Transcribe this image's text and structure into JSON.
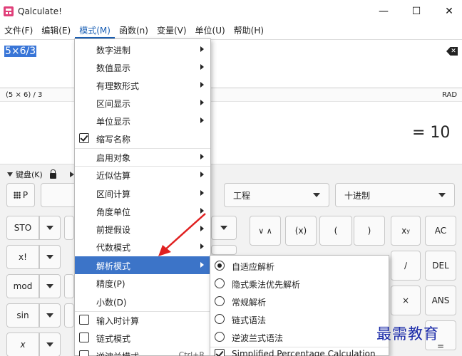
{
  "window": {
    "title": "Qalculate!",
    "minimize": "—",
    "maximize": "☐",
    "close": "✕"
  },
  "menubar": [
    "文件(F)",
    "编辑(E)",
    "模式(M)",
    "函数(n)",
    "变量(V)",
    "单位(U)",
    "帮助(H)"
  ],
  "expression": {
    "value": "5×6/3"
  },
  "parsed": {
    "text": "(5 × 6) / 3",
    "angle_unit": "RAD"
  },
  "result": {
    "text": "= 10"
  },
  "keypad": {
    "header_label": "键盘(K)",
    "fn_button": "P",
    "mode_combo": "工程",
    "base_combo": "十进制",
    "left_buttons": [
      "STO",
      "x!",
      "mod",
      "sin",
      "x"
    ],
    "right_row1": [
      "(x)",
      "(",
      ")",
      "x",
      "AC"
    ],
    "xy_superscript": "y",
    "side_ops": [
      "∕",
      "×",
      "="
    ],
    "side_right": [
      "DEL",
      "ANS"
    ],
    "updown": "∨ ∧"
  },
  "mode_menu": {
    "items": [
      {
        "label": "数字进制",
        "submenu": true
      },
      {
        "label": "数值显示",
        "submenu": true
      },
      {
        "label": "有理数形式",
        "submenu": true
      },
      {
        "label": "区间显示",
        "submenu": true
      },
      {
        "label": "单位显示",
        "submenu": true
      },
      {
        "label": "缩写名称",
        "checkbox": true,
        "checked": true
      },
      {
        "label": "启用对象",
        "submenu": true
      },
      {
        "label": "近似估算",
        "submenu": true
      },
      {
        "label": "区间计算",
        "submenu": true
      },
      {
        "label": "角度单位",
        "submenu": true
      },
      {
        "label": "前提假设",
        "submenu": true
      },
      {
        "label": "代数模式",
        "submenu": true
      },
      {
        "label": "解析模式",
        "submenu": true,
        "highlighted": true
      },
      {
        "label": "精度(P)"
      },
      {
        "label": "小数(D)"
      },
      {
        "label": "输入时计算",
        "checkbox": true,
        "checked": false
      },
      {
        "label": "链式模式",
        "checkbox": true,
        "checked": false
      },
      {
        "label": "逆波兰模式",
        "checkbox": true,
        "checked": false,
        "shortcut": "Ctrl+R"
      }
    ]
  },
  "parse_submenu": {
    "items": [
      {
        "label": "自适应解析",
        "radio": true,
        "selected": true
      },
      {
        "label": "隐式乘法优先解析",
        "radio": true,
        "selected": false
      },
      {
        "label": "常规解析",
        "radio": true,
        "selected": false
      },
      {
        "label": "链式语法",
        "radio": true,
        "selected": false
      },
      {
        "label": "逆波兰式语法",
        "radio": true,
        "selected": false
      },
      {
        "label": "Simplified Percentage Calculation",
        "checkbox": true,
        "checked": true
      }
    ]
  },
  "watermark": "最需教育",
  "colors": {
    "highlight": "#3c74c8",
    "annotation_arrow": "#e02020",
    "watermark": "#1a2aa8"
  }
}
